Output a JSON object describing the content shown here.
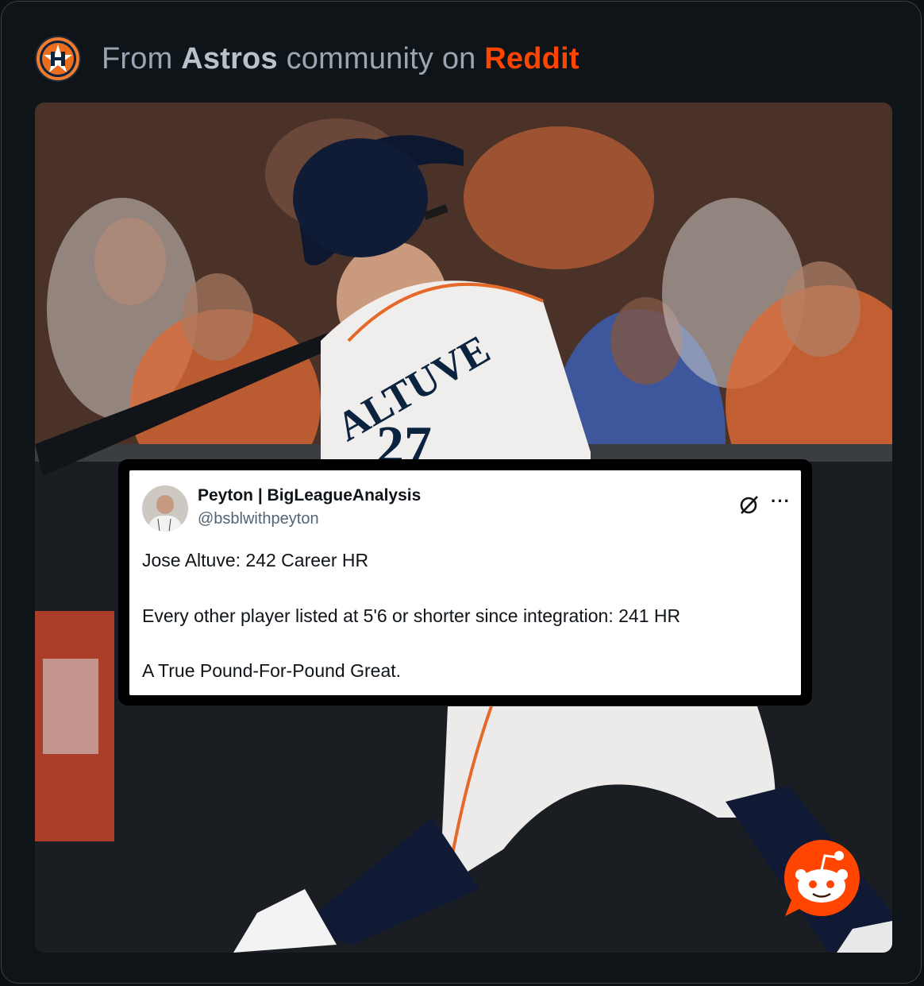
{
  "header": {
    "prefix": "From",
    "community": "Astros",
    "middle": "community on",
    "platform": "Reddit",
    "avatar_icon": "astros-logo-icon"
  },
  "photo": {
    "jersey_name": "ALTUVE",
    "jersey_number": "27"
  },
  "tweet": {
    "display_name": "Peyton | BigLeagueAnalysis",
    "handle": "@bsblwithpeyton",
    "lines": [
      "Jose Altuve: 242 Career HR",
      "Every other player listed at 5'6 or shorter since integration: 241 HR",
      "A True Pound-For-Pound Great."
    ],
    "more_label": "···",
    "grok_icon": "grok-icon"
  },
  "watermark_icon": "reddit-snoo-icon",
  "colors": {
    "reddit_orange": "#ff4500",
    "astros_orange": "#eb6e1f",
    "background": "#0e1418"
  }
}
